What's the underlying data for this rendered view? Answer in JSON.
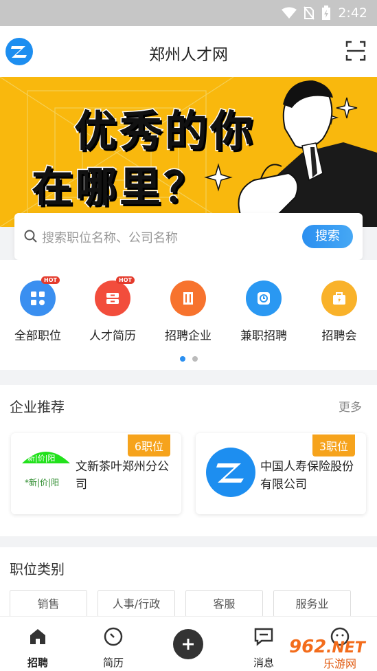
{
  "status_bar": {
    "time": "2:42"
  },
  "header": {
    "title": "郑州人才网"
  },
  "banner": {
    "line1": "优秀的你",
    "line2": "在哪里？"
  },
  "search": {
    "placeholder": "搜索职位名称、公司名称",
    "button": "搜索"
  },
  "menu": {
    "items": [
      {
        "label": "全部职位",
        "color": "#3a8ff0",
        "badge": "HOT"
      },
      {
        "label": "人才简历",
        "color": "#f24d3c",
        "badge": "HOT"
      },
      {
        "label": "招聘企业",
        "color": "#f7732e"
      },
      {
        "label": "兼职招聘",
        "color": "#2a98f2"
      },
      {
        "label": "招聘会",
        "color": "#f9b22a"
      }
    ]
  },
  "companies": {
    "title": "企业推荐",
    "more": "更多",
    "items": [
      {
        "name": "文新茶叶郑州分公司",
        "count": "6职位"
      },
      {
        "name": "中国人寿保险股份有限公司",
        "count": "3职位"
      }
    ]
  },
  "categories": {
    "title": "职位类别",
    "tags": [
      "销售",
      "人事/行政",
      "客服",
      "服务业"
    ]
  },
  "tabbar": {
    "items": [
      {
        "label": "招聘"
      },
      {
        "label": "简历"
      },
      {
        "label": "消息"
      }
    ]
  },
  "watermark": "962.NET 乐游网",
  "colors": {
    "accent": "#2b8ff0",
    "banner": "#f9b80d",
    "badge": "#f6a31c"
  }
}
